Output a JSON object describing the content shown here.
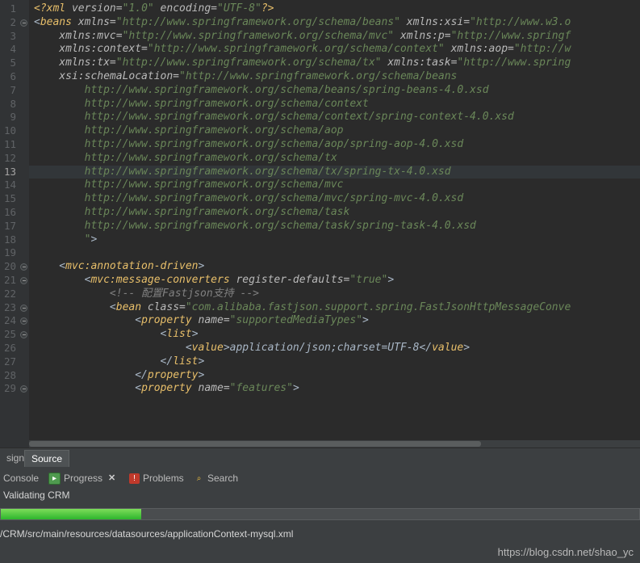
{
  "editor": {
    "lines": [
      {
        "n": "1",
        "fold": false,
        "hl": false,
        "spans": [
          {
            "c": "pi",
            "t": "<?xml "
          },
          {
            "c": "attr",
            "t": "version="
          },
          {
            "c": "str",
            "t": "\"1.0\""
          },
          {
            "c": "attr",
            "t": " encoding="
          },
          {
            "c": "str",
            "t": "\"UTF-8\""
          },
          {
            "c": "pi",
            "t": "?>"
          }
        ]
      },
      {
        "n": "2",
        "fold": true,
        "hl": false,
        "spans": [
          {
            "c": "plain",
            "t": "<"
          },
          {
            "c": "tagname",
            "t": "beans"
          },
          {
            "c": "attr",
            "t": " xmlns="
          },
          {
            "c": "str",
            "t": "\"http://www.springframework.org/schema/beans\""
          },
          {
            "c": "attr",
            "t": " xmlns:xsi="
          },
          {
            "c": "str",
            "t": "\"http://www.w3.o"
          }
        ]
      },
      {
        "n": "3",
        "fold": false,
        "hl": false,
        "spans": [
          {
            "c": "attr",
            "t": "    xmlns:mvc="
          },
          {
            "c": "str",
            "t": "\"http://www.springframework.org/schema/mvc\""
          },
          {
            "c": "attr",
            "t": " xmlns:p="
          },
          {
            "c": "str",
            "t": "\"http://www.springf"
          }
        ]
      },
      {
        "n": "4",
        "fold": false,
        "hl": false,
        "spans": [
          {
            "c": "attr",
            "t": "    xmlns:context="
          },
          {
            "c": "str",
            "t": "\"http://www.springframework.org/schema/context\""
          },
          {
            "c": "attr",
            "t": " xmlns:aop="
          },
          {
            "c": "str",
            "t": "\"http://w"
          }
        ]
      },
      {
        "n": "5",
        "fold": false,
        "hl": false,
        "spans": [
          {
            "c": "attr",
            "t": "    xmlns:tx="
          },
          {
            "c": "str",
            "t": "\"http://www.springframework.org/schema/tx\""
          },
          {
            "c": "attr",
            "t": " xmlns:task="
          },
          {
            "c": "str",
            "t": "\"http://www.spring"
          }
        ]
      },
      {
        "n": "6",
        "fold": false,
        "hl": false,
        "spans": [
          {
            "c": "attr",
            "t": "    xsi:schemaLocation="
          },
          {
            "c": "str",
            "t": "\"http://www.springframework.org/schema/beans"
          }
        ]
      },
      {
        "n": "7",
        "fold": false,
        "hl": false,
        "spans": [
          {
            "c": "str",
            "t": "        http://www.springframework.org/schema/beans/spring-beans-4.0.xsd"
          }
        ]
      },
      {
        "n": "8",
        "fold": false,
        "hl": false,
        "spans": [
          {
            "c": "str",
            "t": "        http://www.springframework.org/schema/context"
          }
        ]
      },
      {
        "n": "9",
        "fold": false,
        "hl": false,
        "spans": [
          {
            "c": "str",
            "t": "        http://www.springframework.org/schema/context/spring-context-4.0.xsd"
          }
        ]
      },
      {
        "n": "10",
        "fold": false,
        "hl": false,
        "spans": [
          {
            "c": "str",
            "t": "        http://www.springframework.org/schema/aop"
          }
        ]
      },
      {
        "n": "11",
        "fold": false,
        "hl": false,
        "spans": [
          {
            "c": "str",
            "t": "        http://www.springframework.org/schema/aop/spring-aop-4.0.xsd"
          }
        ]
      },
      {
        "n": "12",
        "fold": false,
        "hl": false,
        "spans": [
          {
            "c": "str",
            "t": "        http://www.springframework.org/schema/tx"
          }
        ]
      },
      {
        "n": "13",
        "fold": false,
        "hl": true,
        "spans": [
          {
            "c": "str",
            "t": "        http://www.springframework.org/schema/tx/spring-tx-4.0.xsd"
          }
        ]
      },
      {
        "n": "14",
        "fold": false,
        "hl": false,
        "spans": [
          {
            "c": "str",
            "t": "        http://www.springframework.org/schema/mvc"
          }
        ]
      },
      {
        "n": "15",
        "fold": false,
        "hl": false,
        "spans": [
          {
            "c": "str",
            "t": "        http://www.springframework.org/schema/mvc/spring-mvc-4.0.xsd"
          }
        ]
      },
      {
        "n": "16",
        "fold": false,
        "hl": false,
        "spans": [
          {
            "c": "str",
            "t": "        http://www.springframework.org/schema/task"
          }
        ]
      },
      {
        "n": "17",
        "fold": false,
        "hl": false,
        "spans": [
          {
            "c": "str",
            "t": "        http://www.springframework.org/schema/task/spring-task-4.0.xsd"
          }
        ]
      },
      {
        "n": "18",
        "fold": false,
        "hl": false,
        "spans": [
          {
            "c": "str",
            "t": "        \""
          },
          {
            "c": "plain",
            "t": ">"
          }
        ]
      },
      {
        "n": "19",
        "fold": false,
        "hl": false,
        "spans": []
      },
      {
        "n": "20",
        "fold": true,
        "hl": false,
        "spans": [
          {
            "c": "plain",
            "t": "    <"
          },
          {
            "c": "tagname",
            "t": "mvc:annotation-driven"
          },
          {
            "c": "plain",
            "t": ">"
          }
        ]
      },
      {
        "n": "21",
        "fold": true,
        "hl": false,
        "spans": [
          {
            "c": "plain",
            "t": "        <"
          },
          {
            "c": "tagname",
            "t": "mvc:message-converters"
          },
          {
            "c": "attr",
            "t": " register-defaults="
          },
          {
            "c": "str",
            "t": "\"true\""
          },
          {
            "c": "plain",
            "t": ">"
          }
        ]
      },
      {
        "n": "22",
        "fold": false,
        "hl": false,
        "spans": [
          {
            "c": "comment",
            "t": "            <!-- 配置Fastjson支持 -->"
          }
        ]
      },
      {
        "n": "23",
        "fold": true,
        "hl": false,
        "spans": [
          {
            "c": "plain",
            "t": "            <"
          },
          {
            "c": "tagname",
            "t": "bean"
          },
          {
            "c": "attr",
            "t": " class="
          },
          {
            "c": "str",
            "t": "\"com.alibaba.fastjson.support.spring.FastJsonHttpMessageConve"
          }
        ]
      },
      {
        "n": "24",
        "fold": true,
        "hl": false,
        "spans": [
          {
            "c": "plain",
            "t": "                <"
          },
          {
            "c": "tagname",
            "t": "property"
          },
          {
            "c": "attr",
            "t": " name="
          },
          {
            "c": "str",
            "t": "\"supportedMediaTypes\""
          },
          {
            "c": "plain",
            "t": ">"
          }
        ]
      },
      {
        "n": "25",
        "fold": true,
        "hl": false,
        "spans": [
          {
            "c": "plain",
            "t": "                    <"
          },
          {
            "c": "tagname",
            "t": "list"
          },
          {
            "c": "plain",
            "t": ">"
          }
        ]
      },
      {
        "n": "26",
        "fold": false,
        "hl": false,
        "spans": [
          {
            "c": "plain",
            "t": "                        <"
          },
          {
            "c": "tagname",
            "t": "value"
          },
          {
            "c": "plain",
            "t": ">"
          },
          {
            "c": "text",
            "t": "application/json;charset=UTF-8"
          },
          {
            "c": "plain",
            "t": "</"
          },
          {
            "c": "tagname",
            "t": "value"
          },
          {
            "c": "plain",
            "t": ">"
          }
        ]
      },
      {
        "n": "27",
        "fold": false,
        "hl": false,
        "spans": [
          {
            "c": "plain",
            "t": "                    </"
          },
          {
            "c": "tagname",
            "t": "list"
          },
          {
            "c": "plain",
            "t": ">"
          }
        ]
      },
      {
        "n": "28",
        "fold": false,
        "hl": false,
        "spans": [
          {
            "c": "plain",
            "t": "                </"
          },
          {
            "c": "tagname",
            "t": "property"
          },
          {
            "c": "plain",
            "t": ">"
          }
        ]
      },
      {
        "n": "29",
        "fold": true,
        "hl": false,
        "spans": [
          {
            "c": "plain",
            "t": "                <"
          },
          {
            "c": "tagname",
            "t": "property"
          },
          {
            "c": "attr",
            "t": " name="
          },
          {
            "c": "str",
            "t": "\"features\""
          },
          {
            "c": "plain",
            "t": ">"
          }
        ]
      }
    ]
  },
  "editor_tabs": {
    "design_label": "sign",
    "source_label": "Source"
  },
  "panel": {
    "tabs": [
      {
        "label": "Console",
        "icon": "",
        "close": false
      },
      {
        "label": "Progress",
        "icon": "progress-icon",
        "close": true
      },
      {
        "label": "Problems",
        "icon": "problems-icon",
        "close": false
      },
      {
        "label": "Search",
        "icon": "search-icon-el",
        "close": false
      }
    ],
    "status_text": "Validating CRM",
    "progress_percent": 22,
    "path_text": "/CRM/src/main/resources/datasources/applicationContext-mysql.xml"
  },
  "watermark": "https://blog.csdn.net/shao_yc"
}
